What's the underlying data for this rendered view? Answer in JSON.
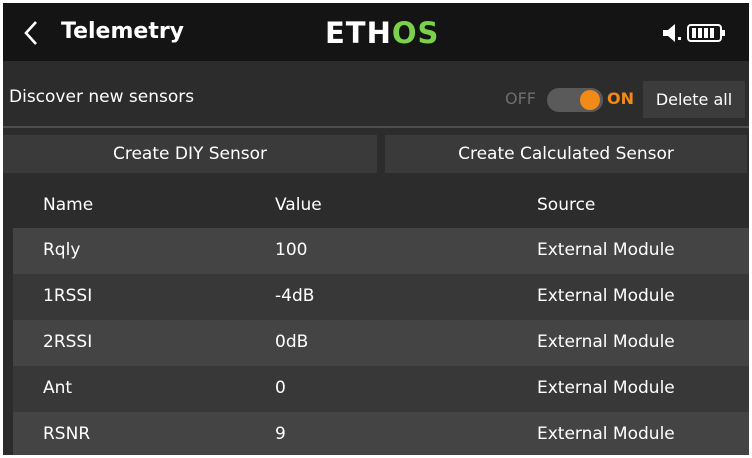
{
  "header": {
    "back_icon": "chevron-left-icon",
    "title": "Telemetry",
    "logo_main": "ETH",
    "logo_accent": "OS",
    "logo_accent_color": "#7bd24a",
    "status_icons": [
      "speaker-icon",
      "battery-icon"
    ]
  },
  "discover": {
    "label": "Discover new sensors",
    "toggle_off_label": "OFF",
    "toggle_on_label": "ON",
    "toggle_state": "on",
    "accent_color": "#f28a17",
    "delete_all_label": "Delete all"
  },
  "actions": {
    "create_diy_label": "Create DIY Sensor",
    "create_calculated_label": "Create Calculated Sensor"
  },
  "table": {
    "columns": [
      "Name",
      "Value",
      "Source"
    ],
    "rows": [
      {
        "name": "Rqly",
        "value": "100",
        "source": "External Module"
      },
      {
        "name": "1RSSI",
        "value": "-4dB",
        "source": "External Module"
      },
      {
        "name": "2RSSI",
        "value": "0dB",
        "source": "External Module"
      },
      {
        "name": "Ant",
        "value": "0",
        "source": "External Module"
      },
      {
        "name": "RSNR",
        "value": "9",
        "source": "External Module"
      }
    ]
  }
}
